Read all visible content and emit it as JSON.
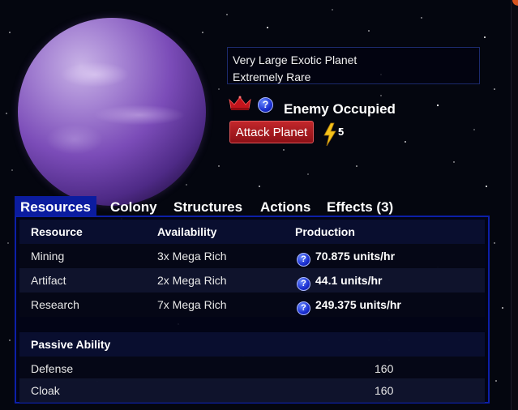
{
  "planet": {
    "size_type": "Very Large Exotic Planet",
    "rarity": "Extremely Rare",
    "status": "Enemy Occupied",
    "help_glyph": "?",
    "icons": {
      "crown": "crown-icon",
      "help": "question-icon",
      "energy": "lightning-bolt-icon"
    }
  },
  "actions": {
    "attack_label": "Attack Planet",
    "energy_cost": "5"
  },
  "tabs": [
    {
      "label": "Resources",
      "active": true
    },
    {
      "label": "Colony",
      "active": false
    },
    {
      "label": "Structures",
      "active": false
    },
    {
      "label": "Actions",
      "active": false
    },
    {
      "label": "Effects (3)",
      "active": false
    }
  ],
  "resources": {
    "headers": {
      "resource": "Resource",
      "availability": "Availability",
      "production": "Production"
    },
    "rows": [
      {
        "resource": "Mining",
        "availability": "3x Mega Rich",
        "production": "70.875 units/hr"
      },
      {
        "resource": "Artifact",
        "availability": "2x Mega Rich",
        "production": "44.1 units/hr"
      },
      {
        "resource": "Research",
        "availability": "7x Mega Rich",
        "production": "249.375 units/hr"
      }
    ]
  },
  "passive": {
    "header": "Passive Ability",
    "rows": [
      {
        "name": "Defense",
        "value": "160"
      },
      {
        "name": "Cloak",
        "value": "160"
      }
    ]
  },
  "colors": {
    "tab_active": "#0b1c9f",
    "panel_border": "#0c1fa8",
    "attack_button": "#b31d22",
    "help_icon": "#1a2fd1",
    "planet": "#7b4cb8"
  }
}
